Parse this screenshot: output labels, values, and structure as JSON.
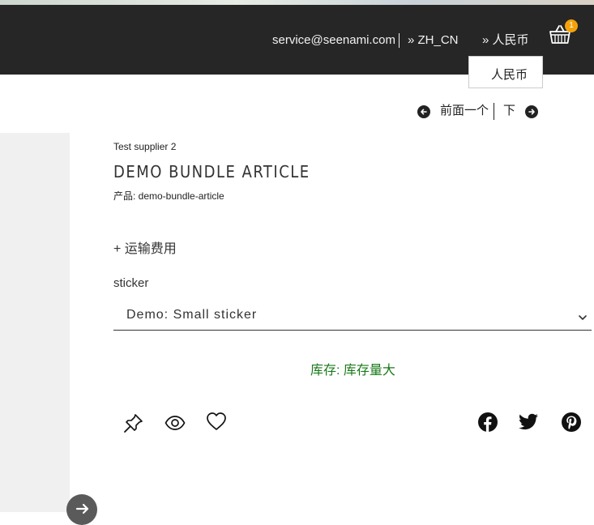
{
  "header": {
    "email": "service@seenami.com",
    "language": "» ZH_CN",
    "currency": "» 人民币",
    "cart_count": "1",
    "currency_dropdown_option": "人民币"
  },
  "pager": {
    "previous_label": "前面一个",
    "next_label": "下"
  },
  "product": {
    "supplier": "Test supplier 2",
    "title": "DEMO BUNDLE ARTICLE",
    "sku_line": "产品: demo-bundle-article",
    "shipping_link": "+ 运输费用",
    "option_label": "sticker",
    "option_selected": "Demo: Small sticker",
    "stock_text": "库存: 库存量大"
  },
  "icons": {
    "cart": "basket-icon",
    "prev": "arrow-left-circle-icon",
    "next": "arrow-right-circle-icon",
    "pin": "pin-icon",
    "view": "eye-icon",
    "wishlist": "heart-icon",
    "facebook": "facebook-icon",
    "twitter": "twitter-icon",
    "pinterest": "pinterest-icon",
    "scroll": "arrow-right-icon"
  },
  "colors": {
    "header_bg": "#262626",
    "badge": "#f5a20a",
    "stock": "#1a7a1a"
  }
}
